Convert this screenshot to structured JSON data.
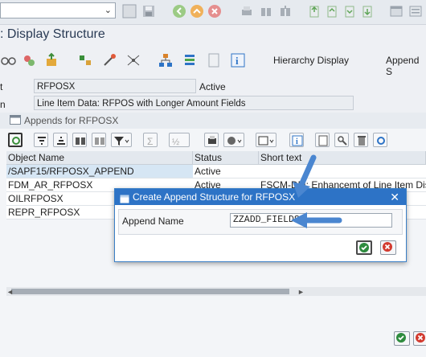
{
  "window": {
    "title": ": Display Structure"
  },
  "toolbar": {
    "command_field_value": "",
    "hierarchy_display_label": "Hierarchy Display",
    "append_label": "Append S"
  },
  "fields": {
    "name_label_fragment": "t",
    "name_value": "RFPOSX",
    "status_value": "Active",
    "desc_label_fragment": "n",
    "desc_value": "Line Item Data: RFPOS with Longer Amount Fields"
  },
  "appends_panel": {
    "title": "Appends for RFPOSX"
  },
  "table": {
    "headers": [
      "Object Name",
      "Status",
      "Short text"
    ],
    "rows": [
      {
        "name": "/SAPF15/RFPOSX_APPEND",
        "status": "Active",
        "text": ""
      },
      {
        "name": "FDM_AR_RFPOSX",
        "status": "Active",
        "text": "FSCM-DM: Enhancemt of Line Item Disp."
      },
      {
        "name": "OILRFPOSX",
        "status": "",
        "text": ""
      },
      {
        "name": "REPR_RFPOSX",
        "status": "",
        "text": ""
      }
    ]
  },
  "dialog": {
    "title": "Create Append Structure for RFPOSX",
    "close_glyph": "✕",
    "append_name_label": "Append Name",
    "append_name_value": "ZZADD_FIELDS"
  },
  "colors": {
    "accent": "#2d73c6",
    "arrow": "#4a86d0",
    "ok_green": "#2e8b3e",
    "cancel_red": "#d23a2f"
  },
  "icons": [
    "dropdown-chevron-icon",
    "save-icon",
    "back-icon",
    "exit-icon",
    "cancel-icon",
    "print-icon",
    "find-icon",
    "find-next-icon",
    "first-page-icon",
    "prev-page-icon",
    "next-page-icon",
    "last-page-icon",
    "new-session-icon",
    "info-icon",
    "continue-icon"
  ]
}
